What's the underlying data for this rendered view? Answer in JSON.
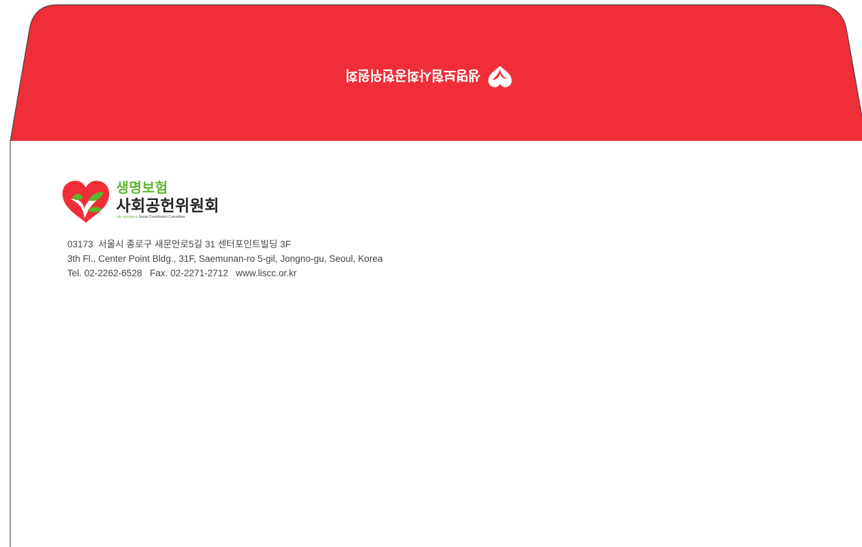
{
  "flap": {
    "color": "#ef2e38",
    "text": "생명보험사회공헌위원회",
    "icon": "heart-leaf-icon"
  },
  "logo": {
    "icon": "heart-leaf-icon",
    "line1": "생명보험",
    "line2": "사회공헌위원회",
    "sub_green": "Life Insurance",
    "sub_rest": " Social Contribution Committee",
    "colors": {
      "red": "#ef2e38",
      "green": "#5cb531",
      "text": "#222222"
    }
  },
  "address": {
    "line1": "03173  서울시 종로구 새문안로5길 31 센터포인트빌딩 3F",
    "line2": "3th Fl., Center Point Bldg., 31F, Saemunan-ro 5-gil, Jongno-gu, Seoul, Korea",
    "line3": "Tel. 02-2262-6528   Fax. 02-2271-2712   www.liscc.or.kr"
  }
}
